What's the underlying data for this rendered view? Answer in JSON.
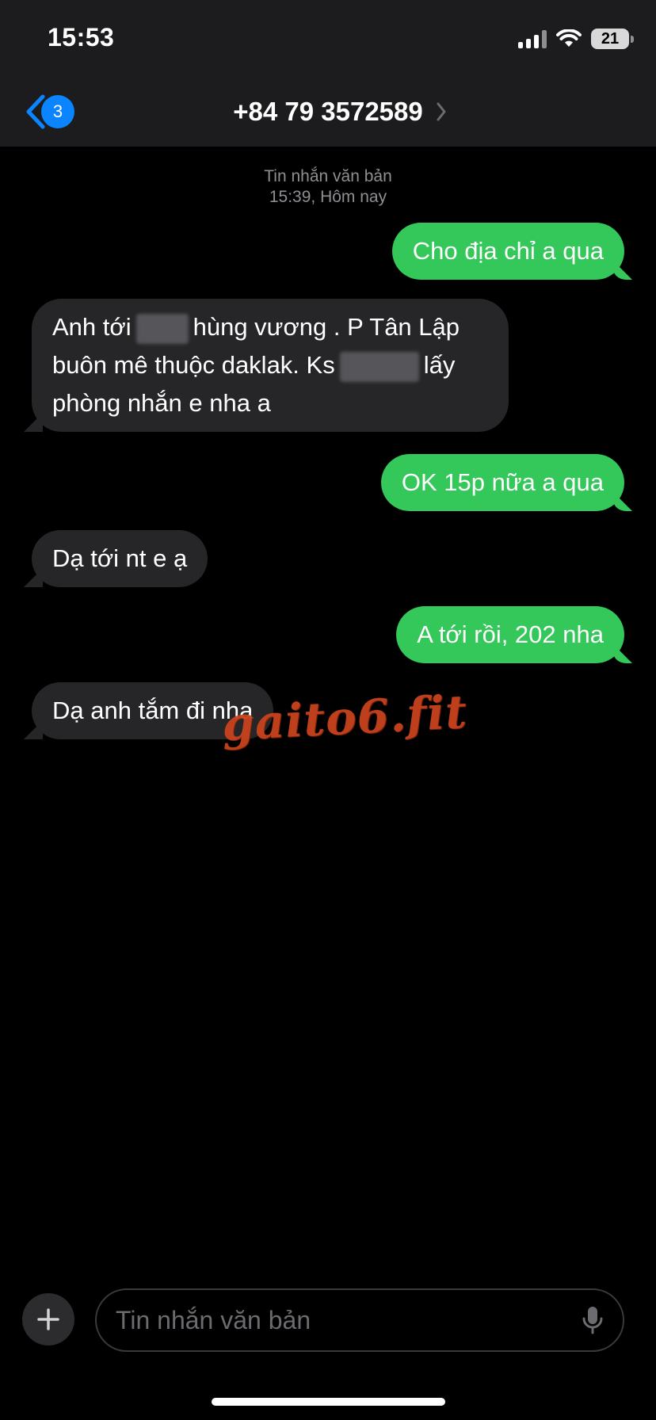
{
  "status_bar": {
    "time": "15:53",
    "battery": "21"
  },
  "header": {
    "back_count": "3",
    "contact_name": "+84 79 3572589"
  },
  "thread": {
    "type_label": "Tin nhắn văn bản",
    "timestamp": "15:39, Hôm nay"
  },
  "messages": [
    {
      "direction": "out",
      "text": "Cho địa chỉ a qua"
    },
    {
      "direction": "in",
      "line1a": "Anh tới",
      "line1b": "hùng vương . P Tân Lập",
      "line2a": "buôn mê thuộc daklak. Ks",
      "line2b": "lấy",
      "line3": "phòng nhắn e nha a"
    },
    {
      "direction": "out",
      "text": "OK 15p nữa a qua"
    },
    {
      "direction": "in",
      "text": "Dạ tới nt e ạ"
    },
    {
      "direction": "out",
      "text": "A tới rồi, 202 nha"
    },
    {
      "direction": "in",
      "text": "Dạ anh tắm đi nha"
    }
  ],
  "watermark": "gaito6.fit",
  "compose": {
    "placeholder": "Tin nhắn văn bản"
  },
  "colors": {
    "outgoing": "#34c759",
    "incoming": "#262628",
    "accent": "#0a84ff",
    "watermark": "#c8431e"
  },
  "icons": [
    "back-chevron-icon",
    "chevron-right-icon",
    "signal-icon",
    "wifi-icon",
    "battery-icon",
    "plus-icon",
    "microphone-icon"
  ]
}
